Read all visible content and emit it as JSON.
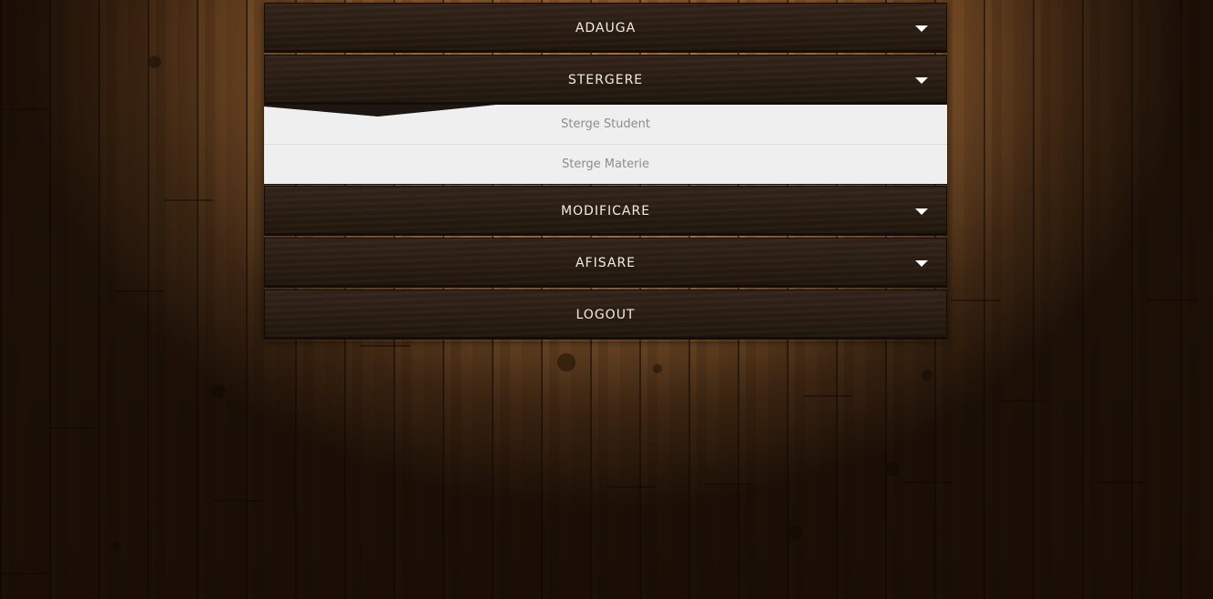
{
  "menu": {
    "items": [
      {
        "label": "ADAUGA",
        "has_arrow": true
      },
      {
        "label": "STERGERE",
        "has_arrow": true,
        "open": true,
        "subitems": [
          {
            "label": "Sterge Student"
          },
          {
            "label": "Sterge Materie"
          }
        ]
      },
      {
        "label": "MODIFICARE",
        "has_arrow": true
      },
      {
        "label": "AFISARE",
        "has_arrow": true
      },
      {
        "label": "LOGOUT",
        "has_arrow": false
      }
    ]
  },
  "icons": {
    "arrow": "chevron-down-icon"
  },
  "colors": {
    "menu_bar": "#2a1d12",
    "menu_text": "#f2ece4",
    "submenu_bg": "#efefef",
    "submenu_text": "#8c8c8c"
  }
}
